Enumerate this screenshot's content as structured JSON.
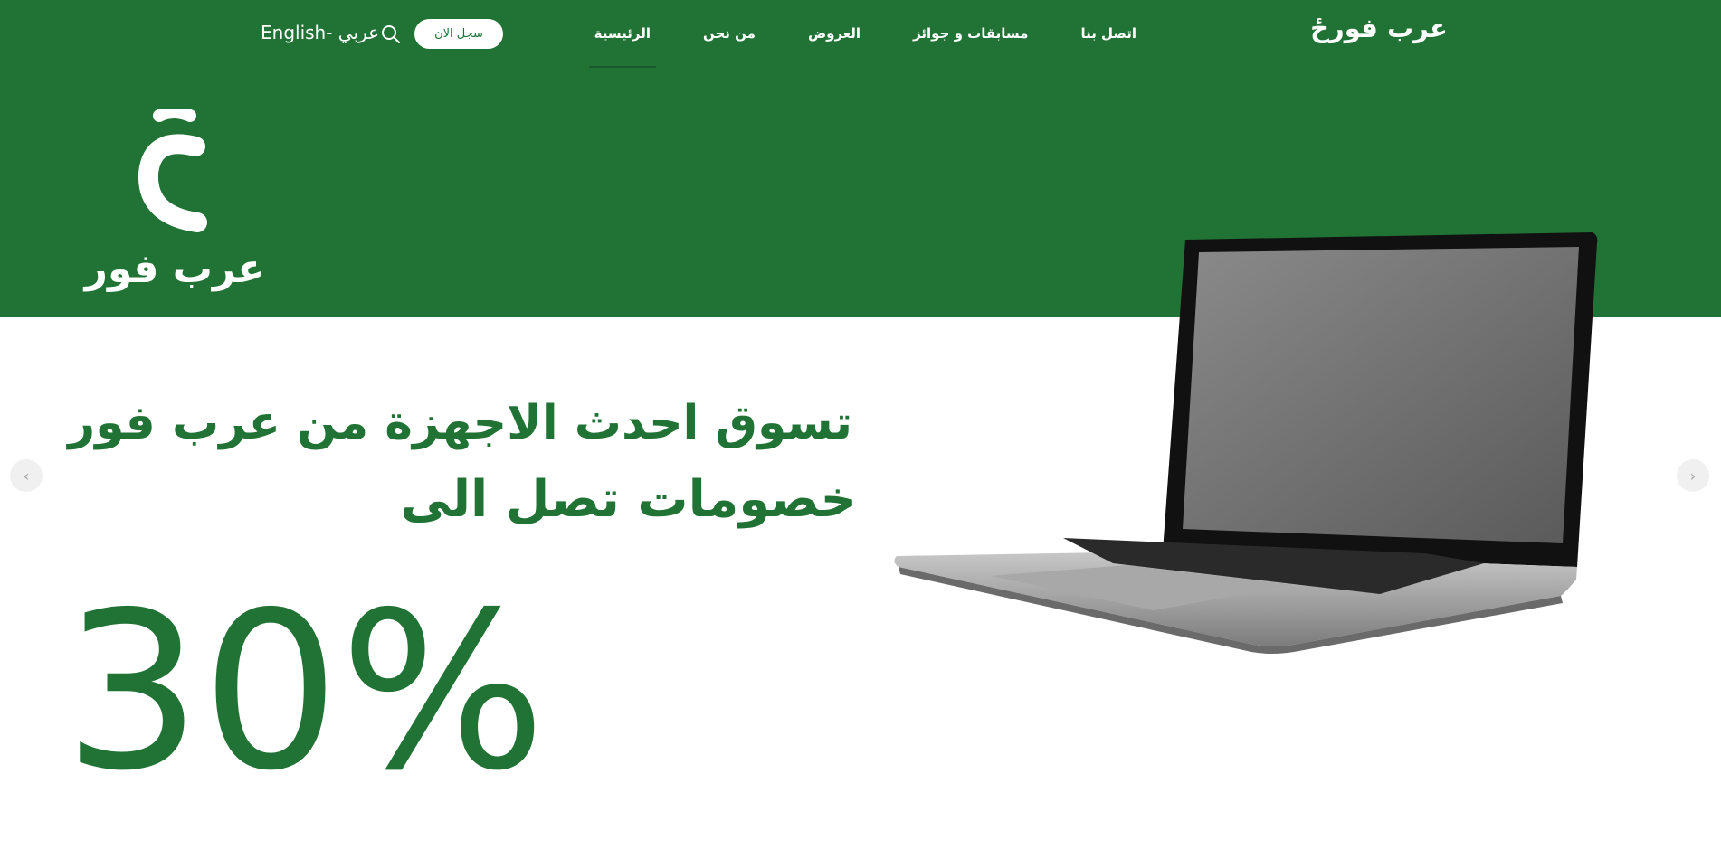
{
  "header": {
    "brand": "عرب فورځ",
    "nav": [
      "الرئيسية",
      "من نحن",
      "العروض",
      "مسابقات و جوائز",
      "اتصل بنا"
    ],
    "active_nav": "الرئيسية",
    "register_label": "سجل الان",
    "search_icon": "search-icon",
    "lang_arabic": "عربي",
    "lang_separator": "-",
    "lang_english": "English"
  },
  "hero": {
    "logo_text": "عرب فور",
    "headline_line1": "تسوق احدث الاجهزة من عرب فور",
    "headline_line2": "خصومات تصل الى",
    "discount": "30%",
    "image_label": "laptop",
    "prev_arrow": "‹",
    "next_arrow": "›"
  },
  "colors": {
    "primary": "#217335",
    "white": "#ffffff",
    "arrow_bg": "#f0f0f0"
  }
}
